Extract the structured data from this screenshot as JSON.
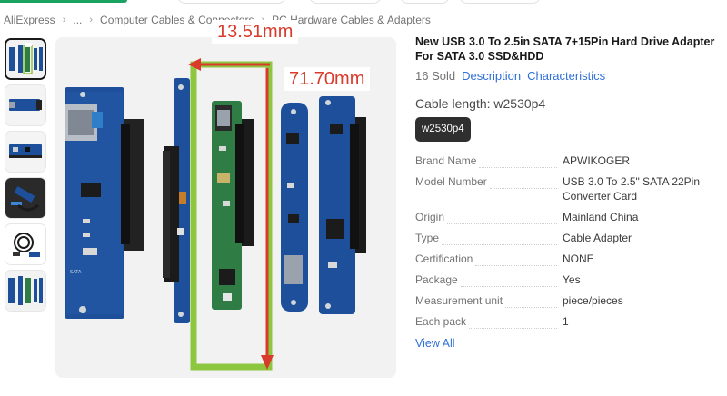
{
  "breadcrumb": {
    "items": [
      "AliExpress",
      "...",
      "Computer Cables & Connectors",
      "PC Hardware Cables & Adapters"
    ]
  },
  "gallery": {
    "thumbnail_count": 6,
    "active_index": 0
  },
  "main_image": {
    "width_label": "13.51mm",
    "length_label": "71.70mm"
  },
  "product": {
    "title": "New USB 3.0 To 2.5in SATA 7+15Pin Hard Drive Adapter For SATA 3.0 SSD&HDD",
    "sold": "16 Sold",
    "description_link": "Description",
    "characteristics_link": "Characteristics",
    "cable_length_label": "Cable length: w2530p4",
    "selected_variant": "w2530p4"
  },
  "specs": [
    {
      "key": "Brand Name",
      "value": "APWIKOGER"
    },
    {
      "key": "Model Number",
      "value": "USB 3.0 To 2.5\" SATA 22Pin Converter Card"
    },
    {
      "key": "Origin",
      "value": "Mainland China"
    },
    {
      "key": "Type",
      "value": "Cable Adapter"
    },
    {
      "key": "Certification",
      "value": "NONE"
    },
    {
      "key": "Package",
      "value": "Yes"
    },
    {
      "key": "Measurement unit",
      "value": "piece/pieces"
    },
    {
      "key": "Each pack",
      "value": "1"
    }
  ],
  "view_all": "View All",
  "colors": {
    "link": "#2e6fd8",
    "dimension_red": "#d93a2b",
    "highlight_green": "#8dc63f",
    "pcb_blue": "#1d4f9a",
    "pcb_green": "#2f7d45",
    "variant_bg": "#2f2f2f"
  }
}
